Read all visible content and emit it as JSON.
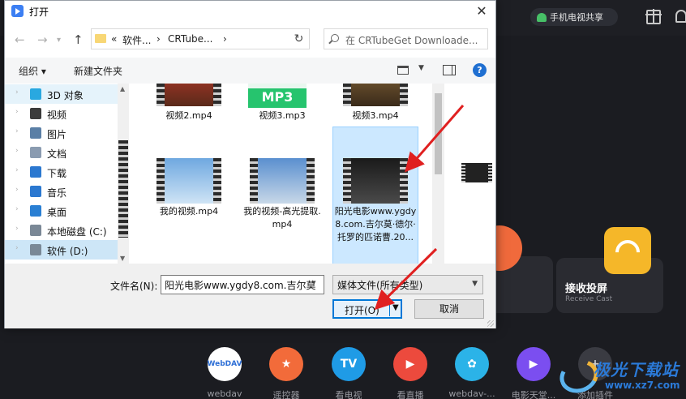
{
  "app": {
    "phone_tv_share": "手机电视共享",
    "cast_card": {
      "title": "接收投屏",
      "subtitle": "Receive Cast"
    },
    "dock": [
      {
        "label": "webdav",
        "icon_text": "WebDAV",
        "color": "#ffffff",
        "text_color": "#2e6fd6",
        "icon": "webdav-icon"
      },
      {
        "label": "遥控器",
        "icon_text": "★",
        "color": "#f26b3a",
        "text_color": "#ffffff",
        "icon": "remote-icon"
      },
      {
        "label": "看电视",
        "icon_text": "TV",
        "color": "#1f9be6",
        "text_color": "#ffffff",
        "icon": "tv-icon"
      },
      {
        "label": "看直播",
        "icon_text": "▶",
        "color": "#ec4a3d",
        "text_color": "#ffffff",
        "icon": "live-icon"
      },
      {
        "label": "webdav-...",
        "icon_text": "✿",
        "color": "#2bb3e8",
        "text_color": "#ffffff",
        "icon": "webdav-plugin-icon"
      },
      {
        "label": "电影天堂...",
        "icon_text": "▶",
        "color": "#7b4ef0",
        "text_color": "#ffffff",
        "icon": "movie-heaven-icon"
      },
      {
        "label": "添加插件",
        "icon_text": "+",
        "color": "#3a3b42",
        "text_color": "#cfcfcf",
        "icon": "add-plugin-icon"
      }
    ],
    "watermark": {
      "name": "极光下载站",
      "url": "www.xz7.com"
    }
  },
  "dialog": {
    "title": "打开",
    "close": "✕",
    "nav": {
      "back": "←",
      "forward": "→",
      "up": "↑",
      "refresh": "↻"
    },
    "breadcrumb": [
      "«",
      "软件...",
      "›",
      "CRTube...",
      "›"
    ],
    "search_placeholder": "在 CRTubeGet Downloade...",
    "toolbar": {
      "organize": "组织 ▾",
      "new_folder": "新建文件夹"
    },
    "sidebar": [
      {
        "label": "3D 对象",
        "icon": "3d-objects-icon",
        "color": "#29a8e0",
        "state": "hover"
      },
      {
        "label": "视频",
        "icon": "videos-icon",
        "color": "#3b3b3b",
        "state": ""
      },
      {
        "label": "图片",
        "icon": "pictures-icon",
        "color": "#5a7fa6",
        "state": ""
      },
      {
        "label": "文档",
        "icon": "documents-icon",
        "color": "#8a9bb0",
        "state": ""
      },
      {
        "label": "下载",
        "icon": "downloads-icon",
        "color": "#2b78d0",
        "state": ""
      },
      {
        "label": "音乐",
        "icon": "music-icon",
        "color": "#2b78d0",
        "state": ""
      },
      {
        "label": "桌面",
        "icon": "desktop-icon",
        "color": "#2a7fd3",
        "state": ""
      },
      {
        "label": "本地磁盘 (C:)",
        "icon": "disk-c-icon",
        "color": "#7a8896",
        "state": ""
      },
      {
        "label": "软件 (D:)",
        "icon": "disk-d-icon",
        "color": "#7a8896",
        "state": "selected"
      }
    ],
    "files": [
      {
        "name": "视频2.mp4",
        "kind": "video",
        "bg": "linear-gradient(#c0392b,#5a2a1a)"
      },
      {
        "name": "视频3.mp3",
        "kind": "mp3",
        "badge": "MP3"
      },
      {
        "name": "视频3.mp4",
        "kind": "video",
        "bg": "linear-gradient(#8a6a3a,#3a2a1a)"
      },
      {
        "name": "我的视频.mp4",
        "kind": "video",
        "bg": "linear-gradient(#6fa8e0,#cfe4f5)"
      },
      {
        "name": "我的视频-高光提取.mp4",
        "kind": "video",
        "bg": "linear-gradient(#5a8fcf,#c8d8e8)"
      },
      {
        "name": "阳光电影www.ygdy8.com.吉尔莫·德尔·托罗的匹诺曹.20...",
        "kind": "video",
        "bg": "linear-gradient(#1a1a1a,#4a4a4a)",
        "selected": true
      }
    ],
    "filename_label": "文件名(N):",
    "filename_value": "阳光电影www.ygdy8.com.吉尔莫",
    "filetype": "媒体文件(所有类型)",
    "open_label": "打开(O)",
    "cancel_label": "取消"
  }
}
